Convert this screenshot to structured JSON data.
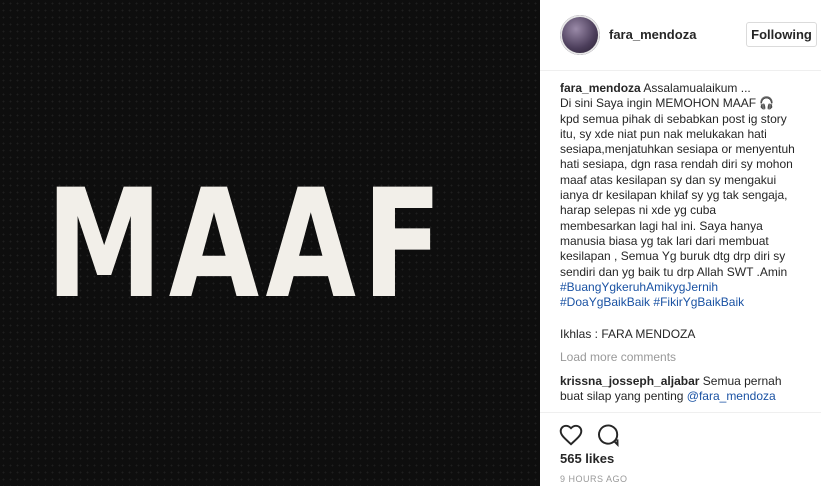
{
  "media": {
    "big_text": "MAAF"
  },
  "header": {
    "username": "fara_mendoza",
    "follow_label": "Following"
  },
  "caption": {
    "username": "fara_mendoza",
    "lines": [
      "Assalamualaikum ...",
      "Di sini Saya ingin MEMOHON MAAF 🎧",
      "kpd semua pihak di sebabkan post ig story",
      "itu, sy xde niat pun nak melukakan hati",
      "sesiapa,menjatuhkan sesiapa or menyentuh",
      "hati sesiapa, dgn rasa rendah diri sy mohon",
      "maaf atas kesilapan sy dan sy mengakui",
      "ianya dr kesilapan khilaf sy yg tak sengaja,",
      "harap selepas ni xde yg cuba",
      "membesarkan lagi hal ini. Saya hanya",
      "manusia biasa yg tak lari dari membuat",
      "kesilapan , Semua Yg buruk dtg drp diri sy",
      "sendiri dan yg baik tu drp Allah SWT .Amin"
    ],
    "hashtags": [
      "#BuangYgkeruhAmikygJernih",
      "#DoaYgBaikBaik",
      "#FikirYgBaikBaik"
    ],
    "sign": "Ikhlas : FARA MENDOZA"
  },
  "load_more": "Load more comments",
  "comment": {
    "username": "krissna_josseph_aljabar",
    "text_line1": "Semua pernah",
    "text_line2": "buat silap yang penting",
    "mention": "@fara_mendoza"
  },
  "likes": "565 likes",
  "time": "9 HOURS AGO"
}
